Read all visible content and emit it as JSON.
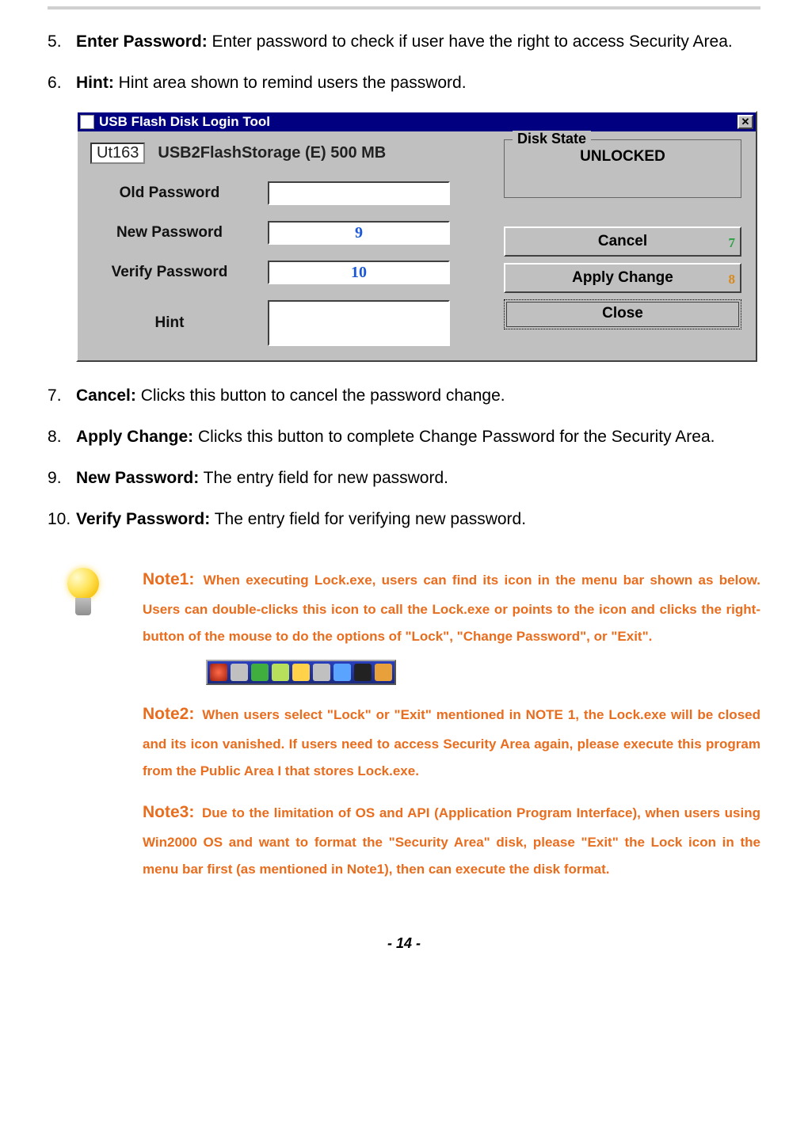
{
  "items_a": [
    {
      "bold": "Enter Password:",
      "text": " Enter password to check if user have the right to access Security Area."
    },
    {
      "bold": "Hint:",
      "text": " Hint area shown to remind users the password."
    }
  ],
  "dialog": {
    "title": "USB Flash Disk Login Tool",
    "close_glyph": "✕",
    "device_chip": "Ut163",
    "device_rest": "USB2FlashStorage (E)  500 MB",
    "labels": {
      "old_pw": "Old Password",
      "new_pw": "New Password",
      "verify_pw": "Verify Password",
      "hint": "Hint"
    },
    "refs": {
      "new_pw": "9",
      "verify_pw": "10",
      "cancel": "7",
      "apply": "8"
    },
    "disk_state": {
      "legend": "Disk State",
      "value": "UNLOCKED"
    },
    "buttons": {
      "cancel": "Cancel",
      "apply": "Apply Change",
      "close": "Close"
    }
  },
  "items_b": [
    {
      "bold": "Cancel:",
      "text": " Clicks this button to cancel the password change."
    },
    {
      "bold": "Apply Change:",
      "text": " Clicks this button to complete Change Password for the Security Area."
    },
    {
      "bold": "New Password:",
      "text": " The entry field for new password."
    },
    {
      "bold": "Verify Password:",
      "text": " The entry field for verifying new password."
    }
  ],
  "notes": {
    "n1_head": "Note1:",
    "n1_body": "When executing Lock.exe, users can find its icon in the menu bar shown as below. Users can double-clicks this icon to call the Lock.exe or points to the icon and clicks the right-button of the mouse to do the options of \"Lock\", \"Change Password\", or \"Exit\".",
    "n2_head": "Note2:",
    "n2_body": "When users select \"Lock\" or \"Exit\" mentioned in NOTE 1, the Lock.exe will be closed and its icon vanished. If users need to access Security Area again, please execute this program from the Public Area I that stores Lock.exe.",
    "n3_head": "Note3:",
    "n3_body": "Due to the limitation of OS and API (Application Program Interface), when users using Win2000 OS and want to format the \"Security Area\" disk, please \"Exit\" the Lock icon in the menu bar first (as mentioned in Note1), then can execute the disk format."
  },
  "page_num": "- 14 -"
}
